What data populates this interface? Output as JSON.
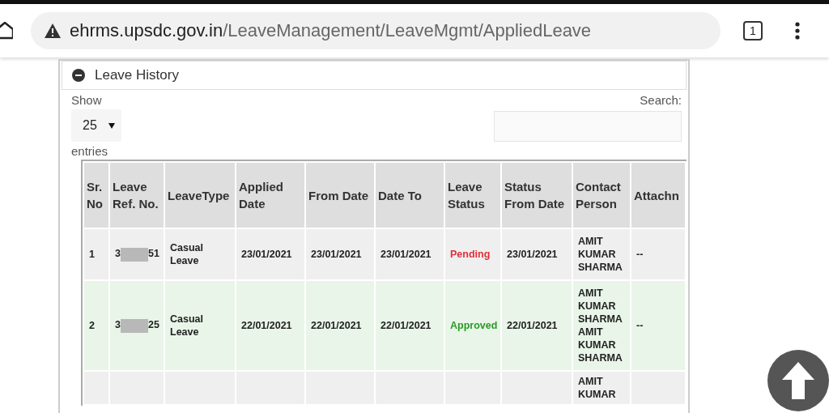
{
  "browser": {
    "url_host": "ehrms.upsdc.gov.in",
    "url_path": "/LeaveManagement/LeaveMgmt/AppliedLeave",
    "tab_count": "1"
  },
  "panel": {
    "title": "Leave History",
    "expanded": true
  },
  "length_menu": {
    "show_label": "Show",
    "value": "25",
    "entries_label": "entries"
  },
  "search": {
    "label": "Search:"
  },
  "table": {
    "columns": [
      "Sr. No",
      "Leave Ref. No.",
      "LeaveType",
      "Applied Date",
      "From Date",
      "Date To",
      "Leave Status",
      "Status From Date",
      "Contact Person",
      "Attachn"
    ],
    "rows": [
      {
        "kind": "pending",
        "sr": "1",
        "ref_start": "3",
        "ref_end": "51",
        "leave_type": "Casual Leave",
        "applied": "23/01/2021",
        "from": "23/01/2021",
        "to": "23/01/2021",
        "status": "Pending",
        "status_from": "23/01/2021",
        "contact": "AMIT KUMAR SHARMA",
        "attachment": "--"
      },
      {
        "kind": "approved",
        "sr": "2",
        "ref_start": "3",
        "ref_end": "25",
        "leave_type": "Casual Leave",
        "applied": "22/01/2021",
        "from": "22/01/2021",
        "to": "22/01/2021",
        "status": "Approved",
        "status_from": "22/01/2021",
        "contact": "AMIT KUMAR SHARMA AMIT KUMAR SHARMA",
        "attachment": "--"
      },
      {
        "kind": "pending",
        "contact": "AMIT KUMAR"
      }
    ]
  }
}
